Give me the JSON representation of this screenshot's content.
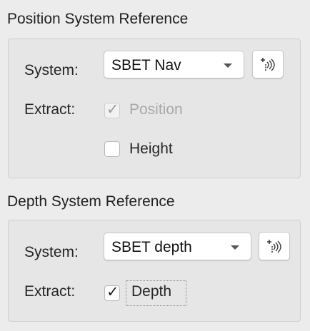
{
  "position_reference": {
    "title": "Position System Reference",
    "system_label": "System:",
    "system_value": "SBET Nav",
    "extract_label": "Extract:",
    "position_checkbox": {
      "label": "Position",
      "checked": true,
      "enabled": false,
      "mark": "✓"
    },
    "height_checkbox": {
      "label": "Height",
      "checked": false,
      "enabled": true,
      "mark": ""
    },
    "tool_button_icon": "sensor-wave-icon"
  },
  "depth_reference": {
    "title": "Depth System Reference",
    "system_label": "System:",
    "system_value": "SBET depth",
    "extract_label": "Extract:",
    "depth_checkbox": {
      "label": "Depth",
      "checked": true,
      "enabled": true,
      "focused": true,
      "mark": "✓"
    },
    "tool_button_icon": "sensor-wave-icon"
  }
}
